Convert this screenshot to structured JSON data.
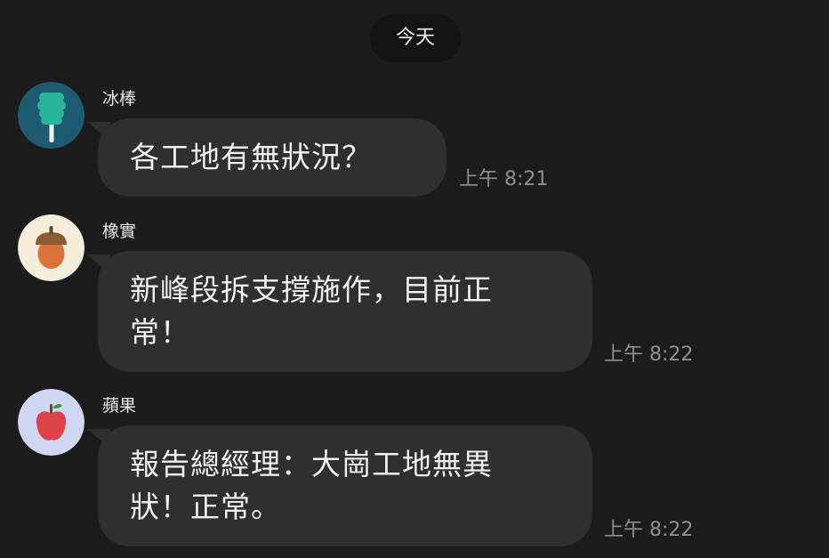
{
  "date_separator": "今天",
  "messages": [
    {
      "sender": "冰棒",
      "avatar_icon": "popsicle-icon",
      "lines": [
        "各工地有無狀況？"
      ],
      "time": "上午 8:21"
    },
    {
      "sender": "橡實",
      "avatar_icon": "acorn-icon",
      "lines": [
        "新峰段拆支撐施作，目前正",
        "常！"
      ],
      "time": "上午 8:22"
    },
    {
      "sender": "蘋果",
      "avatar_icon": "apple-icon",
      "lines": [
        "報告總經理：大崗工地無異",
        "狀！正常。"
      ],
      "time": "上午 8:22"
    }
  ],
  "colors": {
    "background": "#1c1c1c",
    "bubble": "#2f2f2f",
    "date_pill": "#141414",
    "timestamp": "#8f8f8f",
    "popsicle_avatar_bg": "#1d5b72",
    "popsicle": "#2ab59a",
    "acorn_avatar_bg": "#f4eedb",
    "acorn_cap": "#8a5a33",
    "acorn_body": "#d9733a",
    "apple_avatar_bg": "#cfd6f2",
    "apple": "#e0424a",
    "apple_leaf": "#3f9a4a"
  }
}
